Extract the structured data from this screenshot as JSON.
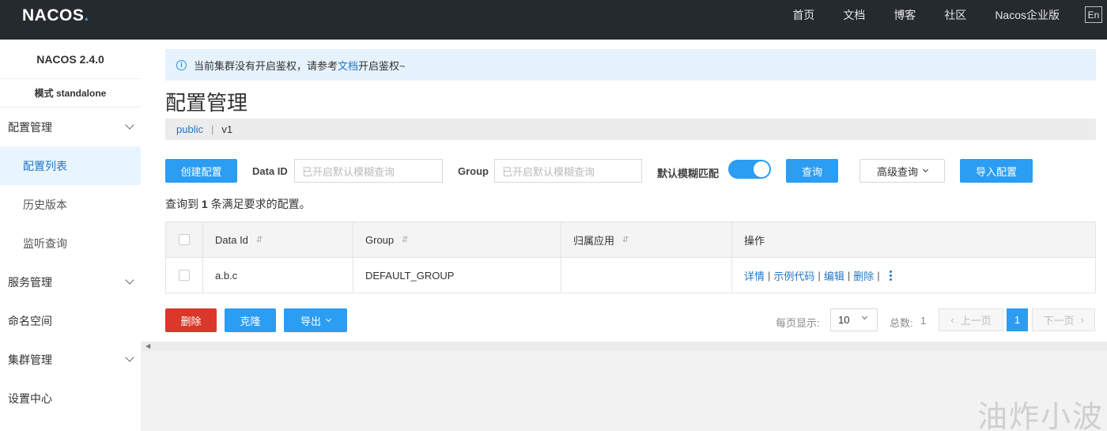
{
  "header": {
    "logo_text": "NACOS",
    "logo_dot": ".",
    "nav": [
      "首页",
      "文档",
      "博客",
      "社区",
      "Nacos企业版"
    ],
    "lang": "En"
  },
  "sidebar": {
    "version": "NACOS 2.4.0",
    "mode": "模式 standalone",
    "items": [
      {
        "label": "配置管理",
        "expandable": true
      },
      {
        "label": "配置列表",
        "sub": true,
        "active": true
      },
      {
        "label": "历史版本",
        "sub": true
      },
      {
        "label": "监听查询",
        "sub": true
      },
      {
        "label": "服务管理",
        "expandable": true
      },
      {
        "label": "命名空间"
      },
      {
        "label": "集群管理",
        "expandable": true
      },
      {
        "label": "设置中心"
      }
    ]
  },
  "notice": {
    "icon": "info-icon",
    "text_before": "当前集群没有开启鉴权，请参考",
    "link": "文档",
    "text_after": "开启鉴权~"
  },
  "page": {
    "title": "配置管理",
    "namespace": "public",
    "separator": "|",
    "namespace_id": "v1"
  },
  "toolbar": {
    "create_label": "创建配置",
    "dataid_label": "Data ID",
    "dataid_placeholder": "已开启默认模糊查询",
    "group_label": "Group",
    "group_placeholder": "已开启默认模糊查询",
    "fuzzy_label": "默认模糊匹配",
    "fuzzy_on": true,
    "query_label": "查询",
    "advanced_label": "高级查询",
    "import_label": "导入配置"
  },
  "result": {
    "prefix": "查询到",
    "count": "1",
    "suffix": "条满足要求的配置。"
  },
  "table": {
    "columns": [
      "Data Id",
      "Group",
      "归属应用",
      "操作"
    ],
    "sort_icon": "⇵",
    "rows": [
      {
        "data_id": "a.b.c",
        "group": "DEFAULT_GROUP",
        "app": "",
        "ops": [
          "详情",
          "示例代码",
          "编辑",
          "删除"
        ]
      }
    ]
  },
  "footer": {
    "delete_label": "删除",
    "clone_label": "克隆",
    "export_label": "导出",
    "per_page_label": "每页显示:",
    "per_page_value": "10",
    "total_label": "总数:",
    "total_value": "1",
    "prev_label": "上一页",
    "next_label": "下一页",
    "current_page": "1"
  },
  "watermark": "油炸小波",
  "colors": {
    "topbar": "#252a2f",
    "primary": "#2b9df2",
    "danger": "#d9382a",
    "link": "#1f77c9"
  }
}
